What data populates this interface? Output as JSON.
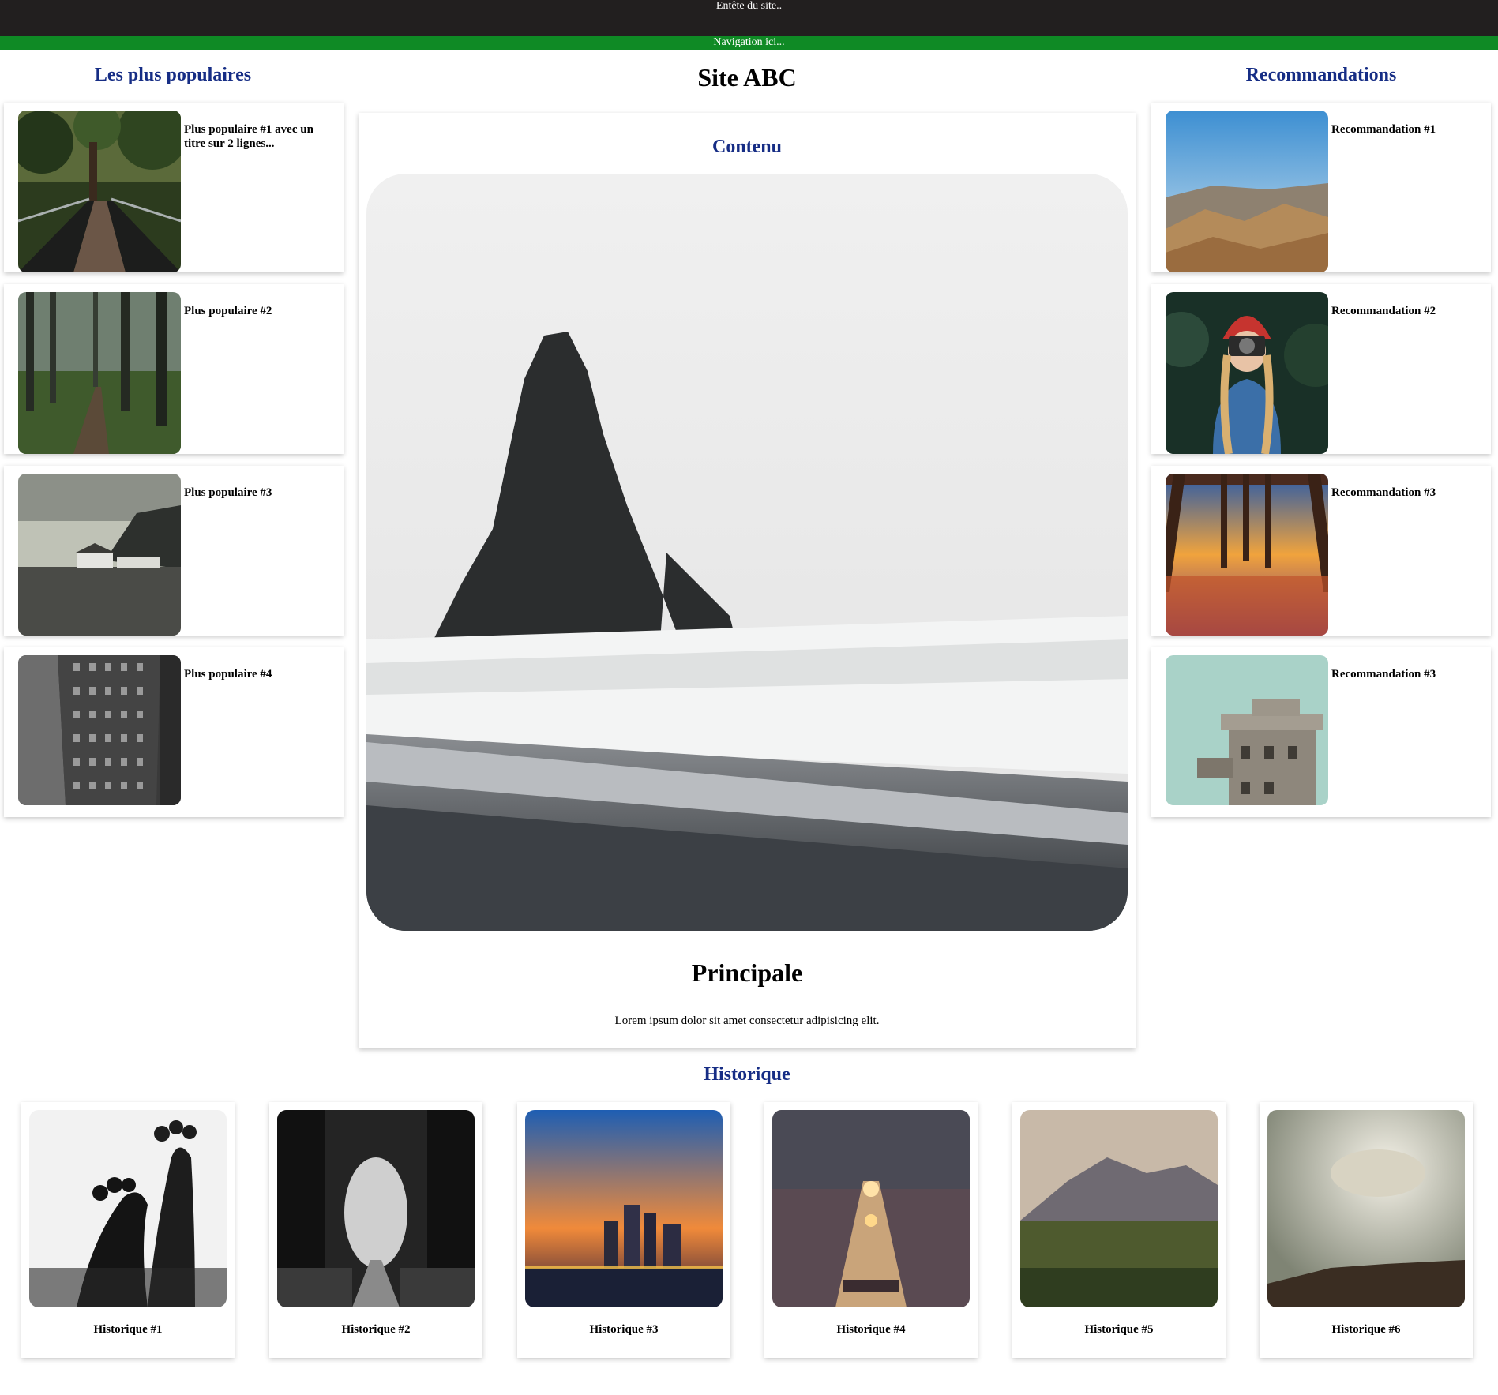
{
  "header": {
    "text": "Entête du site.."
  },
  "nav": {
    "text": "Navigation ici..."
  },
  "left_column": {
    "title": "Les plus populaires",
    "items": [
      {
        "label": "Plus populaire #1 avec un titre sur 2 lignes...",
        "image": "forest-bridge-image"
      },
      {
        "label": "Plus populaire #2",
        "image": "forest-path-image"
      },
      {
        "label": "Plus populaire #3",
        "image": "coastal-cottage-image"
      },
      {
        "label": "Plus populaire #4",
        "image": "tall-building-image"
      }
    ]
  },
  "main": {
    "site_title": "Site ABC",
    "heading": "Contenu",
    "hero_image": "sea-stack-beach-image",
    "title": "Principale",
    "body": "Lorem ipsum dolor sit amet consectetur adipisicing elit."
  },
  "right_column": {
    "title": "Recommandations",
    "items": [
      {
        "label": "Recommandation #1",
        "image": "desert-hills-image"
      },
      {
        "label": "Recommandation #2",
        "image": "photographer-image"
      },
      {
        "label": "Recommandation #3",
        "image": "pier-sunset-image"
      },
      {
        "label": "Recommandation #3",
        "image": "bunker-tower-image"
      }
    ]
  },
  "history": {
    "title": "Historique",
    "items": [
      {
        "label": "Historique #1",
        "image": "feet-silhouette-image"
      },
      {
        "label": "Historique #2",
        "image": "tree-tunnel-image"
      },
      {
        "label": "Historique #3",
        "image": "city-dusk-image"
      },
      {
        "label": "Historique #4",
        "image": "foggy-rail-image"
      },
      {
        "label": "Historique #5",
        "image": "mountain-valley-image"
      },
      {
        "label": "Historique #6",
        "image": "sun-clouds-image"
      }
    ]
  }
}
